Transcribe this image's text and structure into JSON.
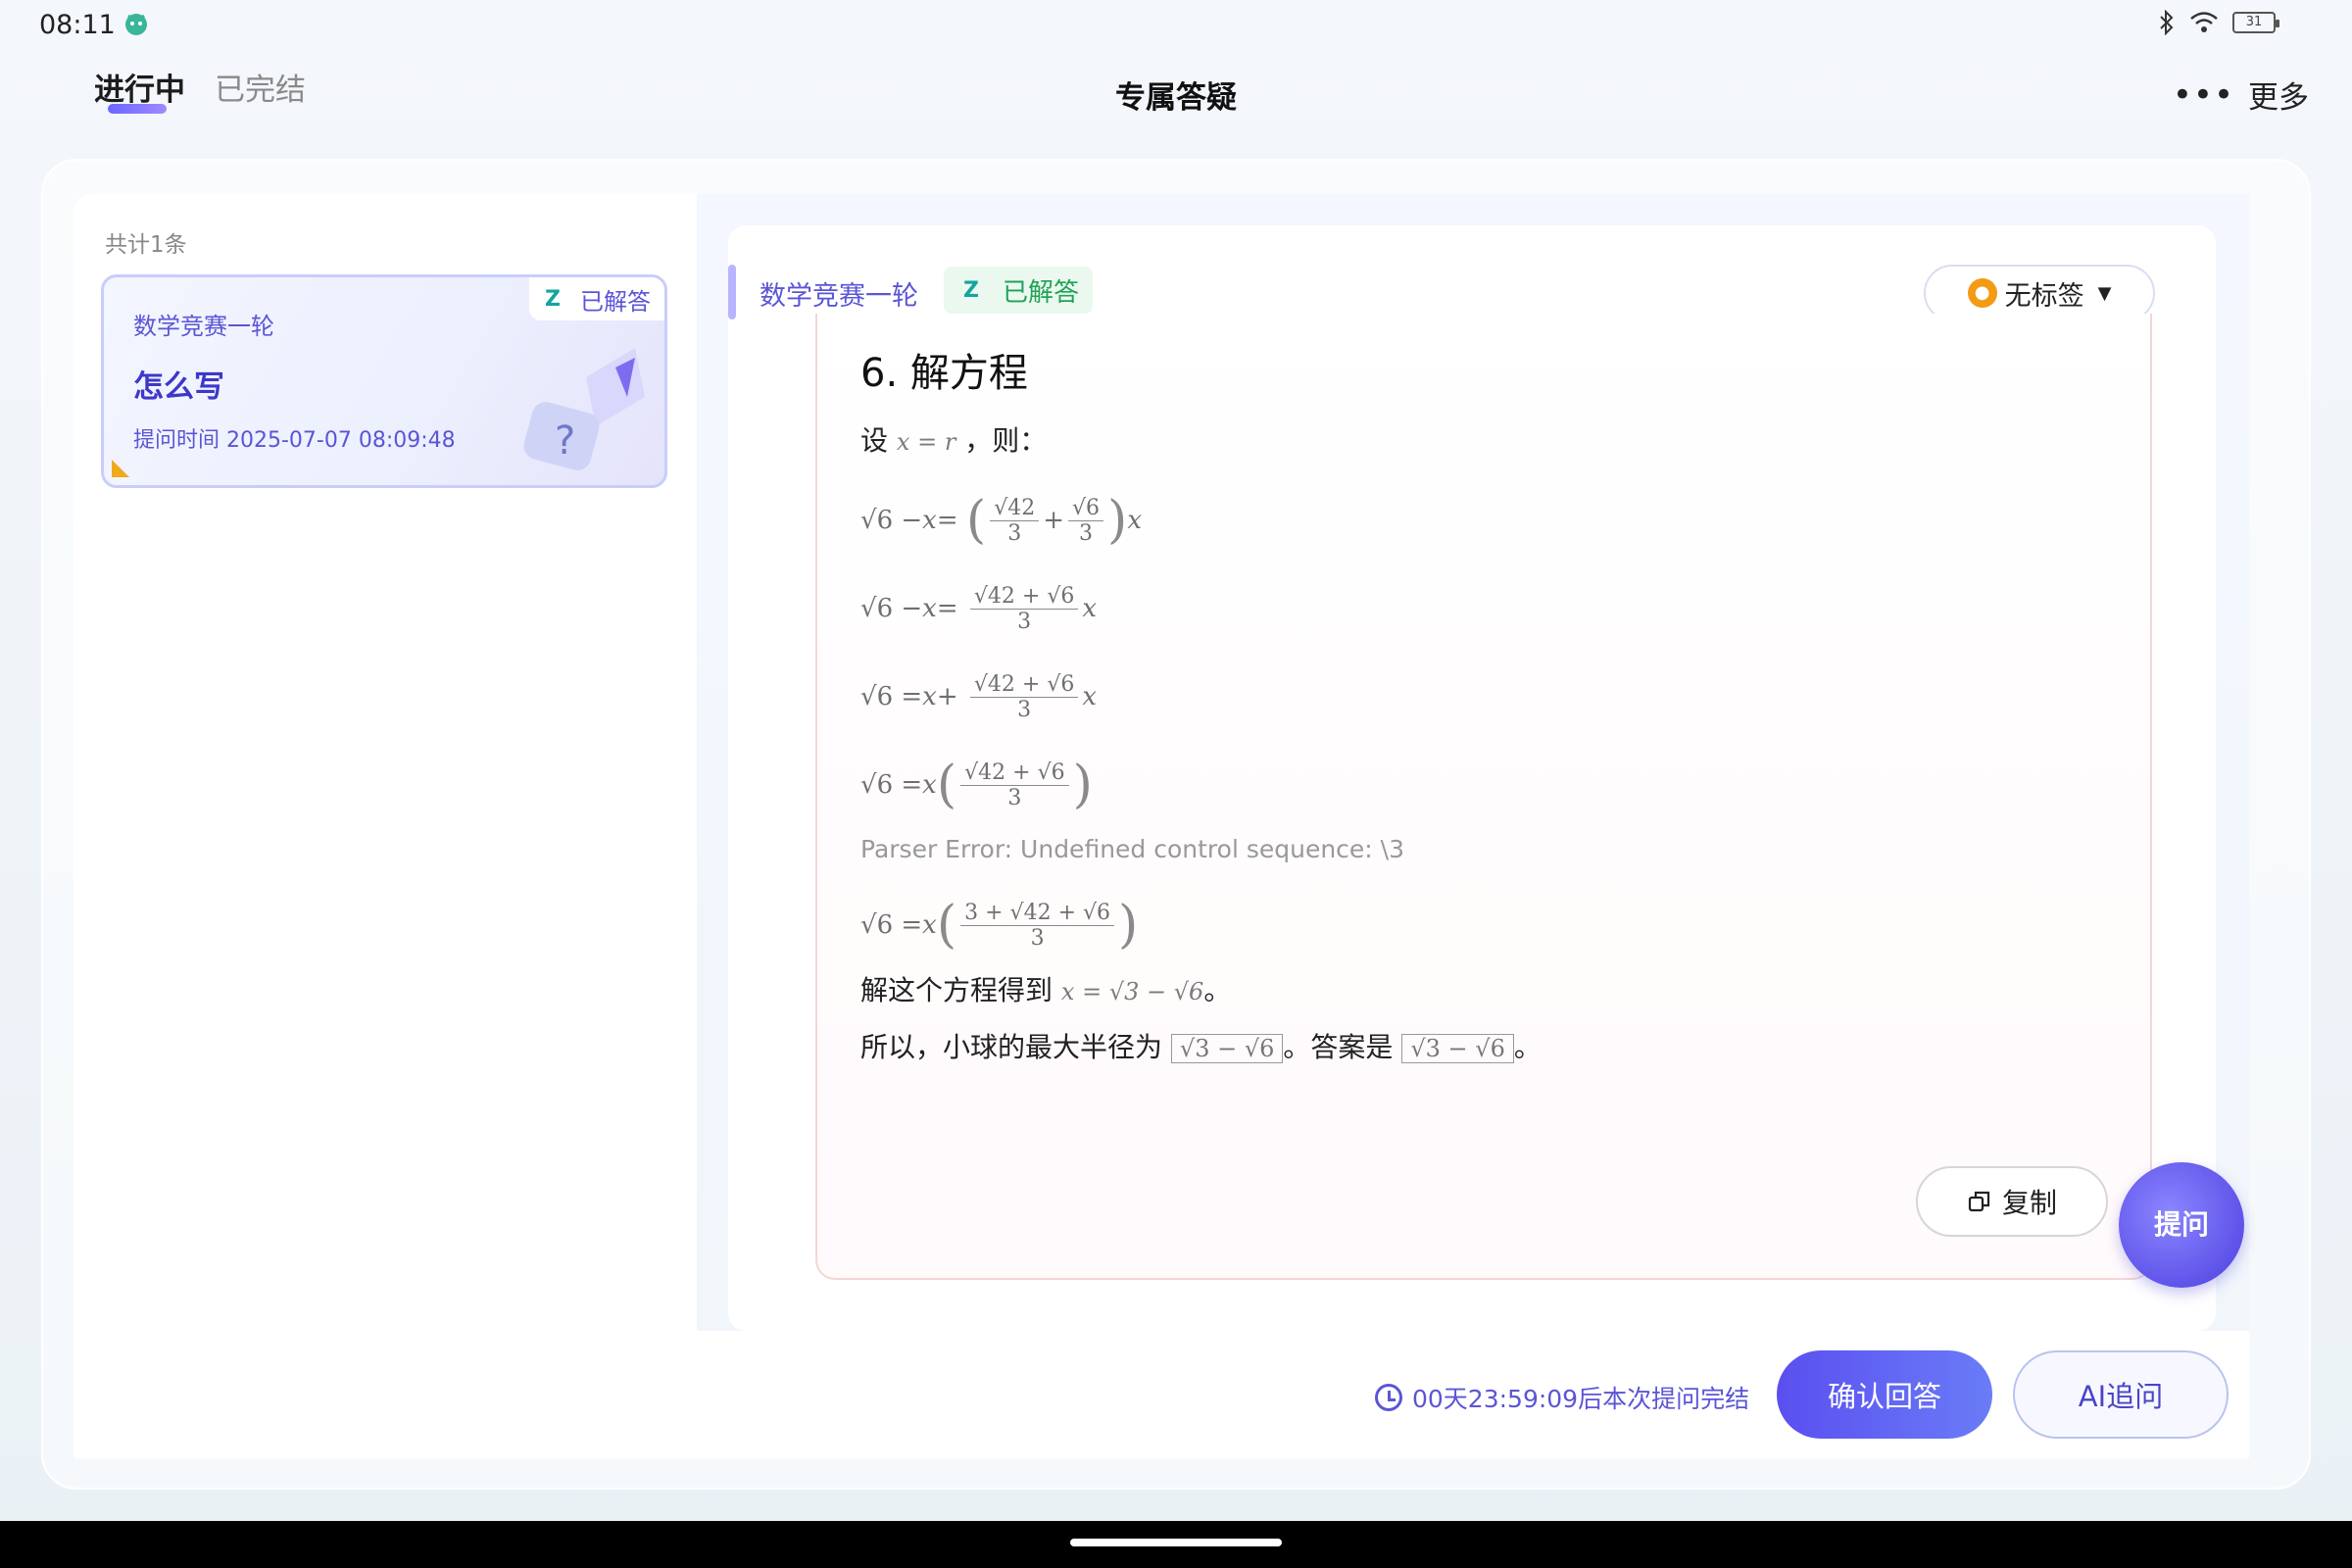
{
  "status_bar": {
    "time": "08:11",
    "battery": "31"
  },
  "header": {
    "tabs": [
      {
        "label": "进行中",
        "active": true
      },
      {
        "label": "已完结",
        "active": false
      }
    ],
    "title": "专属答疑",
    "more_label": "更多"
  },
  "sidebar": {
    "count_label": "共计1条",
    "items": [
      {
        "course": "数学竞赛一轮",
        "badge": "已解答",
        "title": "怎么写",
        "time": "提问时间 2025-07-07 08:09:48"
      }
    ]
  },
  "answer": {
    "course": "数学竞赛一轮",
    "status": "已解答",
    "tag_label": "无标签",
    "section_title": "6. 解方程",
    "intro_prefix": "设",
    "intro_math": "x = r",
    "intro_suffix": "，则：",
    "parser_error": "Parser Error: Undefined control sequence: \\3",
    "solve_prefix": "解这个方程得到",
    "solve_math": "x = √3 − √6",
    "solve_suffix": "。",
    "final_prefix": "所以，小球的最大半径为",
    "final_box1": "√3 − √6",
    "final_mid": "。答案是",
    "final_box2": "√3 − √6",
    "final_suffix": "。",
    "copy_label": "复制",
    "ask_label": "提问"
  },
  "footer": {
    "countdown": "00天23:59:09后本次提问完结",
    "confirm_label": "确认回答",
    "ai_label": "AI追问"
  },
  "colors": {
    "accent": "#5b55d6",
    "success": "#20a257",
    "primary_button": "#5a4ff0"
  }
}
